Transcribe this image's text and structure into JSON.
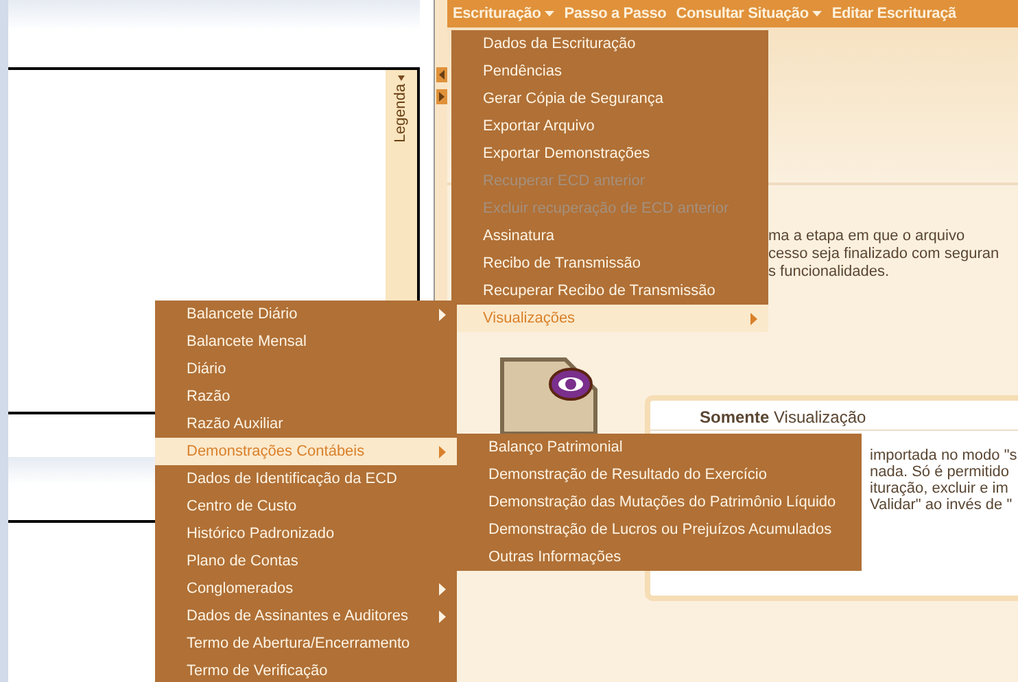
{
  "left_panel": {
    "legend_label": "Legenda"
  },
  "menubar": [
    {
      "label": "Escrituração",
      "has_dropdown": true
    },
    {
      "label": "Passo a Passo",
      "has_dropdown": false
    },
    {
      "label": "Consultar Situação",
      "has_dropdown": true
    },
    {
      "label": "Editar Escrituraçã",
      "has_dropdown": false
    }
  ],
  "escrituracao_menu": [
    {
      "label": "Dados da Escrituração",
      "disabled": false,
      "selected": false,
      "has_submenu": false
    },
    {
      "label": "Pendências",
      "disabled": false,
      "selected": false,
      "has_submenu": false
    },
    {
      "label": "Gerar Cópia de Segurança",
      "disabled": false,
      "selected": false,
      "has_submenu": false
    },
    {
      "label": "Exportar Arquivo",
      "disabled": false,
      "selected": false,
      "has_submenu": false
    },
    {
      "label": "Exportar Demonstrações",
      "disabled": false,
      "selected": false,
      "has_submenu": false
    },
    {
      "label": "Recuperar ECD anterior",
      "disabled": true,
      "selected": false,
      "has_submenu": false
    },
    {
      "label": "Excluir recuperação de ECD anterior",
      "disabled": true,
      "selected": false,
      "has_submenu": false
    },
    {
      "label": "Assinatura",
      "disabled": false,
      "selected": false,
      "has_submenu": false
    },
    {
      "label": "Recibo de Transmissão",
      "disabled": false,
      "selected": false,
      "has_submenu": false
    },
    {
      "label": "Recuperar Recibo de Transmissão",
      "disabled": false,
      "selected": false,
      "has_submenu": false
    },
    {
      "label": "Visualizações",
      "disabled": false,
      "selected": true,
      "has_submenu": true
    }
  ],
  "visualizacoes_submenu": [
    {
      "label": "Balancete Diário",
      "disabled": false,
      "selected": false,
      "has_submenu": true
    },
    {
      "label": "Balancete Mensal",
      "disabled": false,
      "selected": false,
      "has_submenu": false
    },
    {
      "label": "Diário",
      "disabled": false,
      "selected": false,
      "has_submenu": false
    },
    {
      "label": "Razão",
      "disabled": false,
      "selected": false,
      "has_submenu": false
    },
    {
      "label": "Razão Auxiliar",
      "disabled": false,
      "selected": false,
      "has_submenu": false
    },
    {
      "label": "Demonstrações Contábeis",
      "disabled": false,
      "selected": true,
      "has_submenu": true
    },
    {
      "label": "Dados de Identificação da ECD",
      "disabled": false,
      "selected": false,
      "has_submenu": false
    },
    {
      "label": "Centro de Custo",
      "disabled": false,
      "selected": false,
      "has_submenu": false
    },
    {
      "label": "Histórico Padronizado",
      "disabled": false,
      "selected": false,
      "has_submenu": false
    },
    {
      "label": "Plano de Contas",
      "disabled": false,
      "selected": false,
      "has_submenu": false
    },
    {
      "label": "Conglomerados",
      "disabled": false,
      "selected": false,
      "has_submenu": true
    },
    {
      "label": "Dados de Assinantes e Auditores",
      "disabled": false,
      "selected": false,
      "has_submenu": true
    },
    {
      "label": "Termo de Abertura/Encerramento",
      "disabled": false,
      "selected": false,
      "has_submenu": false
    },
    {
      "label": "Termo de Verificação",
      "disabled": false,
      "selected": false,
      "has_submenu": false
    }
  ],
  "demonstracoes_submenu": [
    {
      "label": "Balanço Patrimonial",
      "disabled": false,
      "selected": false,
      "has_submenu": false
    },
    {
      "label": "Demonstração de Resultado do Exercício",
      "disabled": false,
      "selected": false,
      "has_submenu": false
    },
    {
      "label": "Demonstração das Mutações do Patrimônio Líquido",
      "disabled": false,
      "selected": false,
      "has_submenu": false
    },
    {
      "label": "Demonstração de Lucros ou Prejuízos Acumulados",
      "disabled": false,
      "selected": false,
      "has_submenu": false
    },
    {
      "label": "Outras Informações",
      "disabled": false,
      "selected": false,
      "has_submenu": false
    }
  ],
  "intro_text": [
    "ma a etapa em que o arquivo",
    "cesso seja finalizado com seguran",
    "s funcionalidades."
  ],
  "notice_panel": {
    "title": "**Somente** Visualização",
    "lines": [
      "importada no modo \"s",
      "nada. Só é permitido",
      "ituração, excluir e im",
      "Validar\" ao invés de \""
    ]
  }
}
